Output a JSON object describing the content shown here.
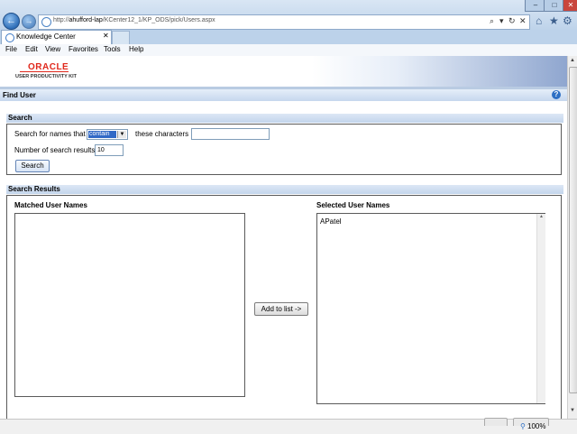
{
  "browser": {
    "url_prefix": "http://",
    "url_host": "ahufford-lap",
    "url_path": "/KCenter12_1/KP_ODS/pick/Users.aspx",
    "tab_title": "Knowledge Center",
    "address_tools": [
      "⌕",
      "▾",
      "↻",
      "✕"
    ],
    "toolbar_icons": [
      "home-icon",
      "star-icon",
      "gear-icon"
    ],
    "window_controls": [
      "–",
      "□",
      "✕"
    ],
    "menu": [
      "File",
      "Edit",
      "View",
      "Favorites",
      "Tools",
      "Help"
    ],
    "zoom": "100%"
  },
  "header": {
    "logo": "ORACLE",
    "subtitle": "USER PRODUCTIVITY KIT"
  },
  "find_user": {
    "title": "Find User"
  },
  "search": {
    "title": "Search",
    "names_label": "Search for names that",
    "match_mode": "contain",
    "chars_label": "these characters",
    "chars_value": "",
    "num_results_label": "Number of search results",
    "num_results_value": "10",
    "button": "Search"
  },
  "results": {
    "title": "Search Results",
    "matched_label": "Matched User Names",
    "matched_items": [],
    "selected_label": "Selected User Names",
    "selected_items": [
      "APatel"
    ],
    "add_button": "Add to list ->"
  }
}
